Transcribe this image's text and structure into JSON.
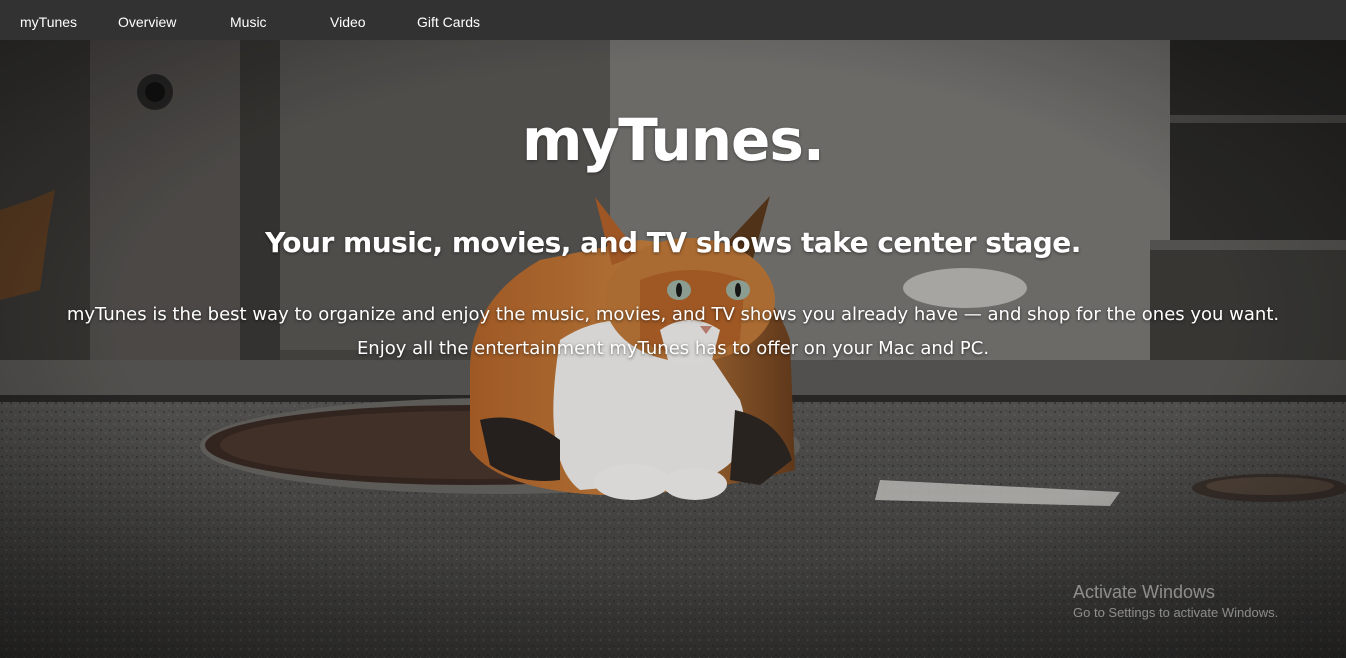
{
  "nav": {
    "brand": "myTunes",
    "items": [
      {
        "label": "Overview"
      },
      {
        "label": "Music"
      },
      {
        "label": "Video"
      },
      {
        "label": "Gift Cards"
      }
    ]
  },
  "hero": {
    "title": "myTunes.",
    "subtitle": "Your music, movies, and TV shows take center stage.",
    "description": "myTunes is the best way to organize and enjoy the music, movies, and TV shows you already have — and shop for the ones you want. Enjoy all the entertainment myTunes has to offer on your Mac and PC.",
    "background_image": "calico-cat-on-street-photo"
  },
  "watermark": {
    "title": "Activate Windows",
    "subtitle": "Go to Settings to activate Windows."
  },
  "colors": {
    "navbar": "#323232",
    "text": "#ffffff"
  }
}
